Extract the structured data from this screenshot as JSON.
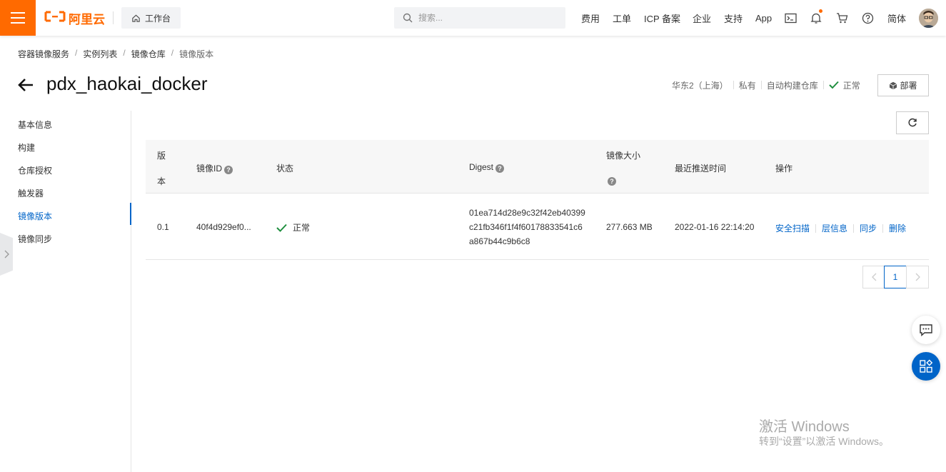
{
  "brand": {
    "logo_text": "阿里云",
    "accent": "#ff6a00",
    "link": "#0064c8"
  },
  "header": {
    "workbench_label": "工作台",
    "search_placeholder": "搜索...",
    "nav": [
      "费用",
      "工单",
      "ICP 备案",
      "企业",
      "支持",
      "App"
    ],
    "lang_label": "简体",
    "icons": [
      "terminal-icon",
      "bell-icon",
      "cart-icon",
      "help-icon"
    ]
  },
  "breadcrumb": [
    "容器镜像服务",
    "实例列表",
    "镜像仓库",
    "镜像版本"
  ],
  "title": "pdx_haokai_docker",
  "meta": {
    "region": "华东2（上海）",
    "visibility": "私有",
    "build": "自动构建仓库",
    "status": "正常"
  },
  "deploy_label": "部署",
  "sidebar": {
    "items": [
      "基本信息",
      "构建",
      "仓库授权",
      "触发器",
      "镜像版本",
      "镜像同步"
    ],
    "active": "镜像版本"
  },
  "table": {
    "headers": {
      "version_line1": "版",
      "version_line2": "本",
      "image_id": "镜像ID",
      "status": "状态",
      "digest": "Digest",
      "size": "镜像大小",
      "pushed": "最近推送时间",
      "actions": "操作"
    },
    "rows": [
      {
        "version": "0.1",
        "image_id": "40f4d929ef0...",
        "status": "正常",
        "digest_lines": [
          "01ea714d28e9c32f42eb40399",
          "c21fb346f1f4f60178833541c6",
          "a867b44c9b6c8"
        ],
        "size": "277.663 MB",
        "pushed": "2022-01-16 22:14:20",
        "actions": [
          "安全扫描",
          "层信息",
          "同步",
          "删除"
        ]
      }
    ]
  },
  "pagination": {
    "current": "1"
  },
  "watermark": {
    "line1": "激活 Windows",
    "line2": "转到“设置”以激活 Windows。"
  }
}
